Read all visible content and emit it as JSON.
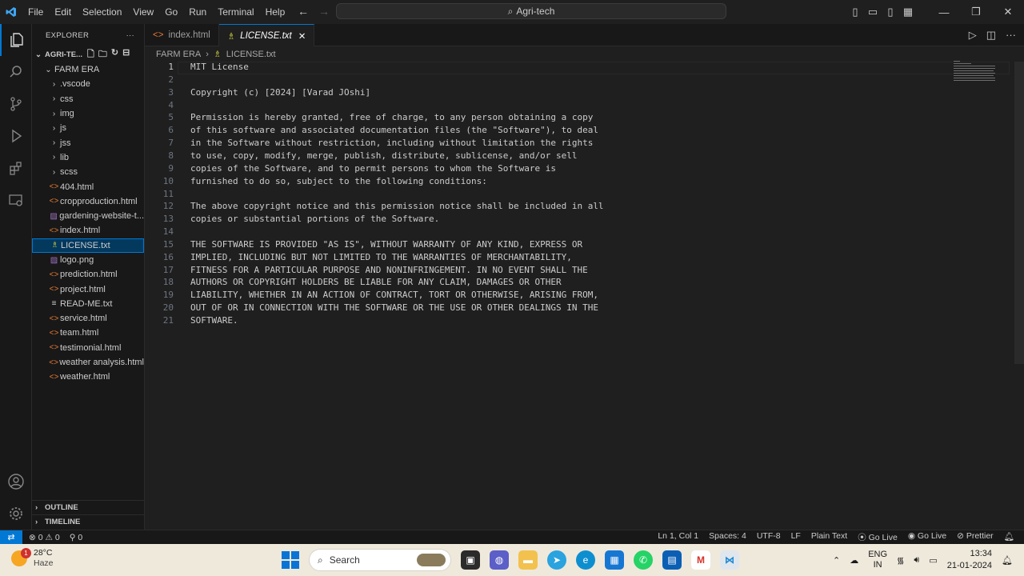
{
  "titlebar": {
    "menus": [
      "File",
      "Edit",
      "Selection",
      "View",
      "Go",
      "Run",
      "Terminal",
      "Help"
    ],
    "search": "Agri-tech"
  },
  "explorer": {
    "title": "EXPLORER",
    "root": "AGRI-TE...",
    "folder": "FARM ERA",
    "items": [
      {
        "name": ".vscode",
        "type": "folder"
      },
      {
        "name": "css",
        "type": "folder"
      },
      {
        "name": "img",
        "type": "folder"
      },
      {
        "name": "js",
        "type": "folder"
      },
      {
        "name": "jss",
        "type": "folder"
      },
      {
        "name": "lib",
        "type": "folder"
      },
      {
        "name": "scss",
        "type": "folder"
      },
      {
        "name": "404.html",
        "type": "html"
      },
      {
        "name": "cropproduction.html",
        "type": "html"
      },
      {
        "name": "gardening-website-t...",
        "type": "image"
      },
      {
        "name": "index.html",
        "type": "html"
      },
      {
        "name": "LICENSE.txt",
        "type": "license"
      },
      {
        "name": "logo.png",
        "type": "image"
      },
      {
        "name": "prediction.html",
        "type": "html"
      },
      {
        "name": "project.html",
        "type": "html"
      },
      {
        "name": "READ-ME.txt",
        "type": "text"
      },
      {
        "name": "service.html",
        "type": "html"
      },
      {
        "name": "team.html",
        "type": "html"
      },
      {
        "name": "testimonial.html",
        "type": "html"
      },
      {
        "name": "weather analysis.html",
        "type": "html"
      },
      {
        "name": "weather.html",
        "type": "html"
      }
    ],
    "selected": "LICENSE.txt",
    "outline": "OUTLINE",
    "timeline": "TIMELINE"
  },
  "tabs": [
    {
      "label": "index.html",
      "icon": "<>"
    },
    {
      "label": "LICENSE.txt",
      "icon": "license",
      "active": true
    }
  ],
  "breadcrumb": [
    "FARM ERA",
    "LICENSE.txt"
  ],
  "editor": {
    "current_line": 1,
    "lines": [
      "MIT License",
      "",
      "Copyright (c) [2024] [Varad JOshi]",
      "",
      "Permission is hereby granted, free of charge, to any person obtaining a copy",
      "of this software and associated documentation files (the \"Software\"), to deal",
      "in the Software without restriction, including without limitation the rights",
      "to use, copy, modify, merge, publish, distribute, sublicense, and/or sell",
      "copies of the Software, and to permit persons to whom the Software is",
      "furnished to do so, subject to the following conditions:",
      "",
      "The above copyright notice and this permission notice shall be included in all",
      "copies or substantial portions of the Software.",
      "",
      "THE SOFTWARE IS PROVIDED \"AS IS\", WITHOUT WARRANTY OF ANY KIND, EXPRESS OR",
      "IMPLIED, INCLUDING BUT NOT LIMITED TO THE WARRANTIES OF MERCHANTABILITY,",
      "FITNESS FOR A PARTICULAR PURPOSE AND NONINFRINGEMENT. IN NO EVENT SHALL THE",
      "AUTHORS OR COPYRIGHT HOLDERS BE LIABLE FOR ANY CLAIM, DAMAGES OR OTHER",
      "LIABILITY, WHETHER IN AN ACTION OF CONTRACT, TORT OR OTHERWISE, ARISING FROM,",
      "OUT OF OR IN CONNECTION WITH THE SOFTWARE OR THE USE OR OTHER DEALINGS IN THE",
      "SOFTWARE."
    ]
  },
  "statusbar": {
    "errors": "0",
    "warnings": "0",
    "ports": "0",
    "position": "Ln 1, Col 1",
    "spaces": "Spaces: 4",
    "encoding": "UTF-8",
    "eol": "LF",
    "language": "Plain Text",
    "golive1": "Go Live",
    "golive2": "Go Live",
    "prettier": "Prettier"
  },
  "taskbar": {
    "temp": "28°C",
    "condition": "Haze",
    "badge": "1",
    "search": "Search",
    "lang1": "ENG",
    "lang2": "IN",
    "time": "13:34",
    "date": "21-01-2024"
  },
  "colors": {
    "accent": "#0078d4",
    "bg": "#1f1f1f",
    "sidebar": "#181818"
  }
}
